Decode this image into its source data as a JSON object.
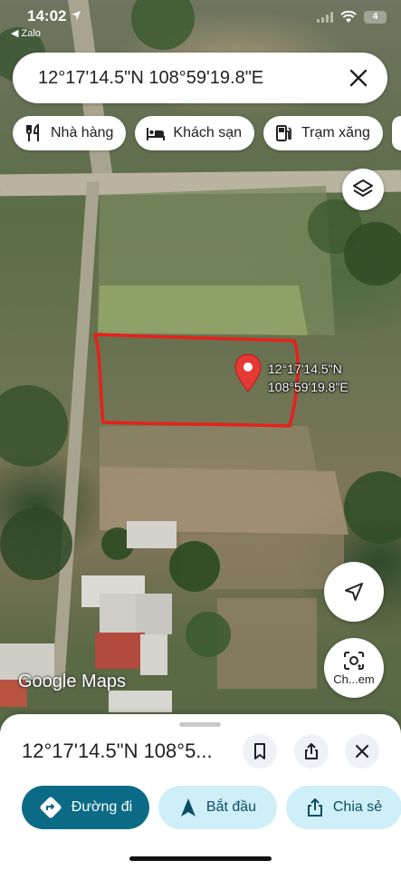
{
  "status_bar": {
    "time": "14:02",
    "back_app": "◀ Zalo",
    "battery": "4"
  },
  "search": {
    "query": "12°17'14.5\"N 108°59'19.8\"E"
  },
  "chips": [
    {
      "label": "Nhà hàng",
      "icon": "restaurant-icon"
    },
    {
      "label": "Khách sạn",
      "icon": "hotel-icon"
    },
    {
      "label": "Trạm xăng",
      "icon": "gas-station-icon"
    }
  ],
  "pin": {
    "line1": "12°17'14.5\"N",
    "line2": "108°59'19.8\"E"
  },
  "map_controls": {
    "lens_label": "Ch...em"
  },
  "branding": {
    "logo": "Google Maps"
  },
  "sheet": {
    "title": "12°17'14.5\"N 108°5...",
    "actions": {
      "directions": "Đường đi",
      "start": "Bắt đầu",
      "share": "Chia sẻ"
    }
  },
  "colors": {
    "primary": "#0b6b86",
    "secondary": "#cfeff8",
    "pin": "#e53935",
    "outline": "#e8201c"
  }
}
